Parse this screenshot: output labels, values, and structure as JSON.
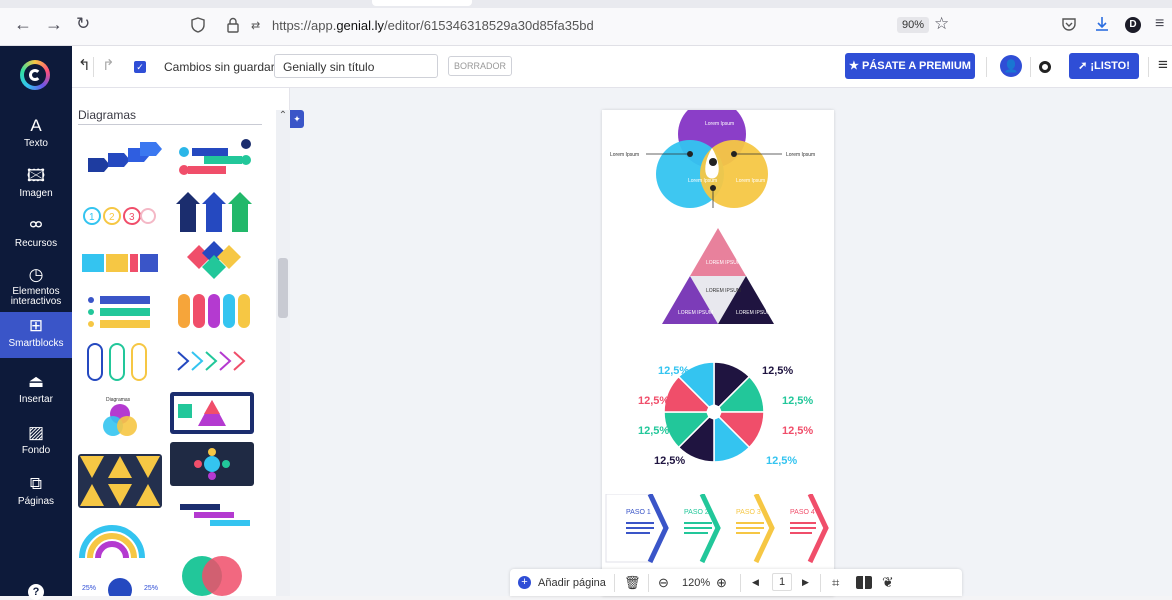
{
  "browser": {
    "url_prefix": "https://app.",
    "url_domain": "genial.ly",
    "url_path": "/editor/615346318529a30d85fa35bd",
    "zoom": "90%"
  },
  "sidebar": {
    "items": [
      {
        "label": "Texto",
        "icon": "text-icon"
      },
      {
        "label": "Imagen",
        "icon": "image-icon"
      },
      {
        "label": "Recursos",
        "icon": "resources-icon"
      },
      {
        "label": "Elementos interactivos",
        "icon": "interactive-icon"
      },
      {
        "label": "Smartblocks",
        "icon": "smartblocks-icon"
      },
      {
        "label": "Insertar",
        "icon": "insert-icon"
      },
      {
        "label": "Fondo",
        "icon": "background-icon"
      },
      {
        "label": "Páginas",
        "icon": "pages-icon"
      }
    ],
    "help": "?"
  },
  "toolbar": {
    "save_status": "Cambios sin guardar",
    "title_value": "Genially sin título",
    "draft_label": "BORRADOR",
    "premium_label": "PÁSATE A PREMIUM",
    "ready_label": "¡LISTO!"
  },
  "panel": {
    "title": "Diagramas"
  },
  "canvas": {
    "venn": {
      "top": "Lorem Ipsum",
      "left": "Lorem Ipsum",
      "right": "Lorem Ipsum",
      "side_left": "Lorem Ipsum",
      "side_right": "Lorem Ipsum"
    },
    "triangle": {
      "top": "LOREM IPSUM",
      "mid": "LOREM IPSUM",
      "left": "LOREM IPSUM",
      "right": "LOREM IPSUM"
    },
    "wheel": {
      "labels": [
        "12,5%",
        "12,5%",
        "12,5%",
        "12,5%",
        "12,5%",
        "12,5%",
        "12,5%",
        "12,5%"
      ]
    },
    "steps": [
      "PASO 1",
      "PASO 2",
      "PASO 3",
      "PASO 4"
    ]
  },
  "bottombar": {
    "add_page": "Añadir página",
    "zoom": "120%",
    "page": "1"
  },
  "colors": {
    "sidebar": "#0d1a3a",
    "accent": "#2f4ed6"
  }
}
